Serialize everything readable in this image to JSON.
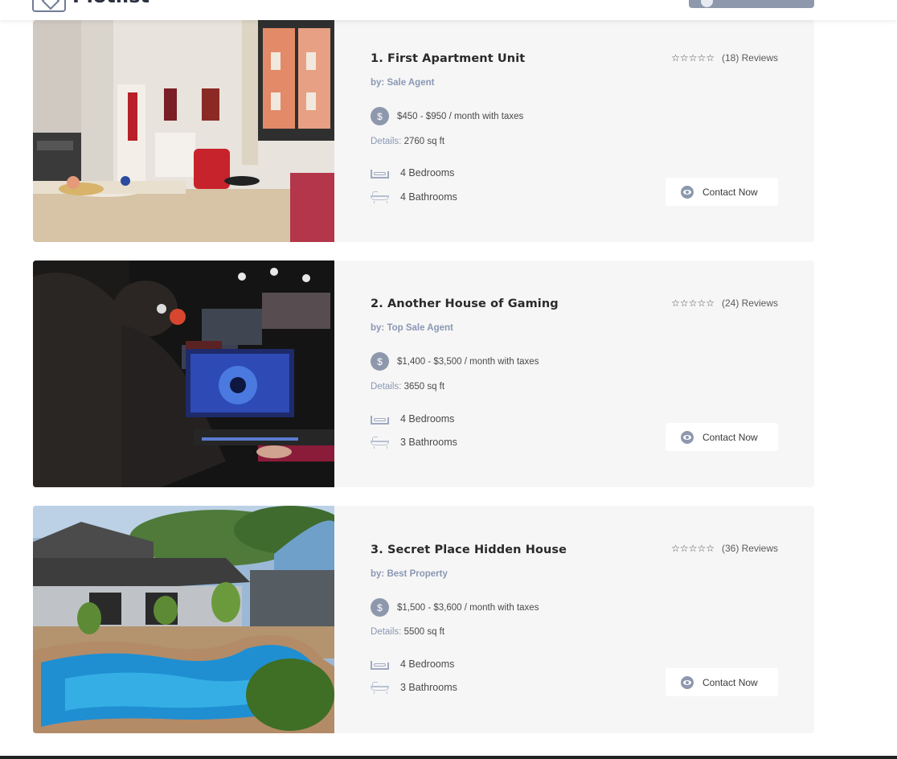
{
  "header": {
    "logo_text": "Plotlist"
  },
  "listings": [
    {
      "title": "1. First Apartment Unit",
      "agent_prefix": "by:",
      "agent_name": "Sale Agent",
      "price": "$450 - $950 / month with taxes",
      "details_label": "Details:",
      "details_value": "2760 sq ft",
      "bedrooms": "4 Bedrooms",
      "bathrooms": "4 Bathrooms",
      "reviews": "(18) Reviews",
      "rating": 0,
      "cta": "Contact Now"
    },
    {
      "title": "2. Another House of Gaming",
      "agent_prefix": "by:",
      "agent_name": "Top Sale Agent",
      "price": "$1,400 - $3,500 / month with taxes",
      "details_label": "Details:",
      "details_value": "3650 sq ft",
      "bedrooms": "4 Bedrooms",
      "bathrooms": "3 Bathrooms",
      "reviews": "(24) Reviews",
      "rating": 0,
      "cta": "Contact Now"
    },
    {
      "title": "3. Secret Place Hidden House",
      "agent_prefix": "by:",
      "agent_name": "Best Property",
      "price": "$1,500 - $3,600 / month with taxes",
      "details_label": "Details:",
      "details_value": "5500 sq ft",
      "bedrooms": "4 Bedrooms",
      "bathrooms": "3 Bathrooms",
      "reviews": "(36) Reviews",
      "rating": 0,
      "cta": "Contact Now"
    }
  ],
  "icons": {
    "price": "coin-icon",
    "bed": "bed-icon",
    "bath": "bathtub-icon",
    "contact": "eye-icon",
    "star": "star-outline-icon"
  },
  "colors": {
    "accent": "#8e98ad",
    "card_bg": "#f6f6f6",
    "agent_text": "#8a97b4"
  }
}
